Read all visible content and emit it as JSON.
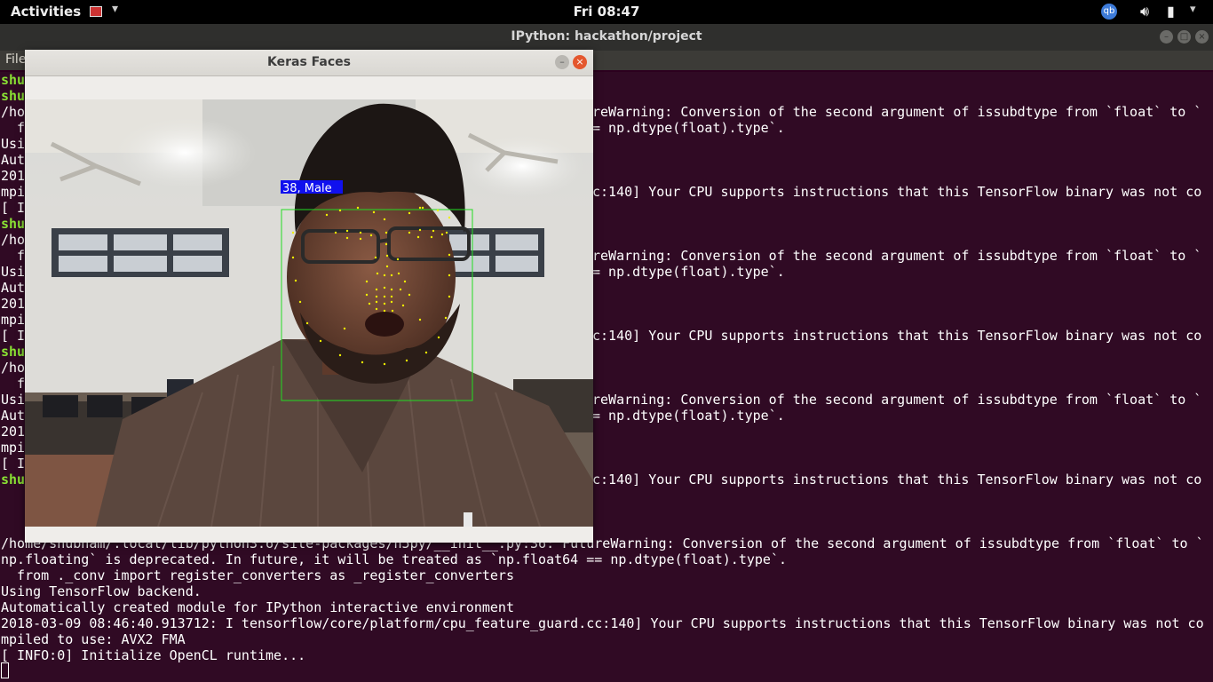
{
  "topbar": {
    "activities": "Activities",
    "clock": "Fri 08:47",
    "user_badge": "qb",
    "volume_icon": "volume-icon",
    "battery_icon": "battery-icon"
  },
  "terminal": {
    "title": "IPython: hackathon/project",
    "menu_first": "File",
    "left_column": [
      "shu",
      "shu",
      "/ho",
      "  f",
      "Usi",
      "Aut",
      "201",
      "mpi",
      "[ I",
      "shu",
      "/ho",
      "  f",
      "Usi",
      "Aut",
      "201",
      "mpi",
      "[ I",
      "shu",
      "/ho",
      "  f",
      "Usi",
      "Aut",
      "201",
      "mpi",
      "[ I",
      "shu"
    ],
    "right_segments": [
      {
        "row": 2,
        "text": "reWarning: Conversion of the second argument of issubdtype from `float` to `"
      },
      {
        "row": 3,
        "text": "= np.dtype(float).type`."
      },
      {
        "row": 7,
        "text": "c:140] Your CPU supports instructions that this TensorFlow binary was not co"
      },
      {
        "row": 11,
        "text": "reWarning: Conversion of the second argument of issubdtype from `float` to `"
      },
      {
        "row": 12,
        "text": "= np.dtype(float).type`."
      },
      {
        "row": 16,
        "text": "c:140] Your CPU supports instructions that this TensorFlow binary was not co"
      },
      {
        "row": 20,
        "text": "reWarning: Conversion of the second argument of issubdtype from `float` to `"
      },
      {
        "row": 21,
        "text": "= np.dtype(float).type`."
      },
      {
        "row": 25,
        "text": "c:140] Your CPU supports instructions that this TensorFlow binary was not co"
      }
    ],
    "full_lines": [
      "/home/shubham/.local/lib/python3.6/site-packages/h5py/__init__.py:36: FutureWarning: Conversion of the second argument of issubdtype from `float` to `",
      "np.floating` is deprecated. In future, it will be treated as `np.float64 == np.dtype(float).type`.",
      "  from ._conv import register_converters as _register_converters",
      "Using TensorFlow backend.",
      "Automatically created module for IPython interactive environment",
      "2018-03-09 08:46:40.913712: I tensorflow/core/platform/cpu_feature_guard.cc:140] Your CPU supports instructions that this TensorFlow binary was not co",
      "mpiled to use: AVX2 FMA",
      "[ INFO:0] Initialize OpenCL runtime..."
    ]
  },
  "keras_window": {
    "title": "Keras Faces",
    "prediction_label": "38, Male",
    "colors": {
      "box": "#22dd22",
      "label_bg": "#1010ee",
      "landmark": "#f0f000"
    }
  }
}
